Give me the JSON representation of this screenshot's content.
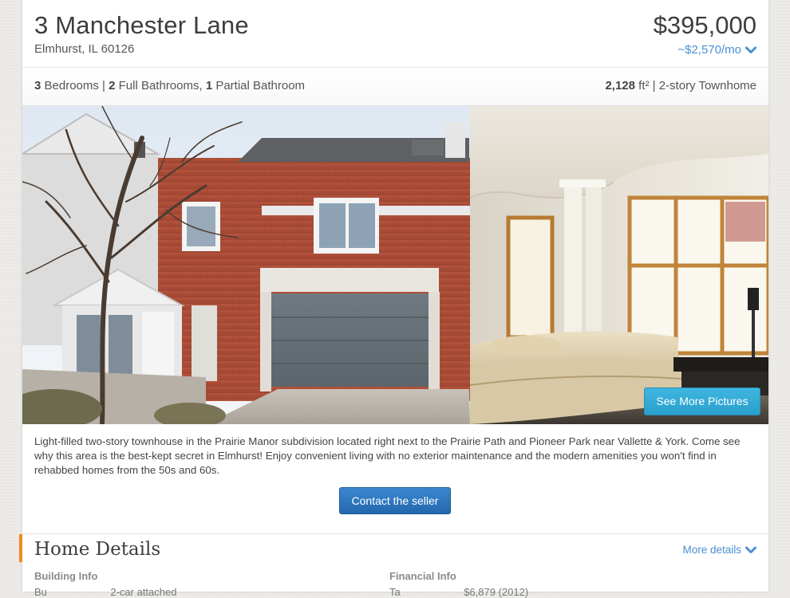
{
  "listing": {
    "address": "3 Manchester Lane",
    "city_line": "Elmhurst, IL 60126",
    "price": "$395,000",
    "monthly": "~$2,570/mo"
  },
  "facts": {
    "bedrooms": "3",
    "bedrooms_label": " Bedrooms | ",
    "full_baths": "2",
    "full_baths_label": " Full Bathrooms, ",
    "partial_baths": "1",
    "partial_baths_label": " Partial Bathroom",
    "sqft": "2,128",
    "sqft_unit": " ft²",
    "home_type": " | 2-story Townhome"
  },
  "photos": {
    "see_more_label": "See More Pictures"
  },
  "description": "Light-filled two-story townhouse in the Prairie Manor subdivision located right next to the Prairie Path and Pioneer Park near Vallette & York. Come see why this area is the best-kept secret in Elmhurst! Enjoy convenient living with no exterior maintenance and the modern amenities you won't find in rehabbed homes from the 50s and 60s.",
  "contact_label": "Contact the seller",
  "home_details": {
    "title": "Home Details",
    "more_label": "More details",
    "building_info": "Building Info",
    "financial_info": "Financial Info",
    "building_row_cut": "Bu                      2-car attached",
    "financial_row_cut": "Ta                      $6,879 (2012)"
  },
  "colors": {
    "link_blue": "#4a8fd3",
    "button_blue": "#2a73bd",
    "photo_button": "#33a9d7",
    "accent_orange": "#f08a1c"
  },
  "icons": {
    "monthly_toggle": "chevron-down-icon",
    "more_details_toggle": "chevron-down-icon"
  }
}
